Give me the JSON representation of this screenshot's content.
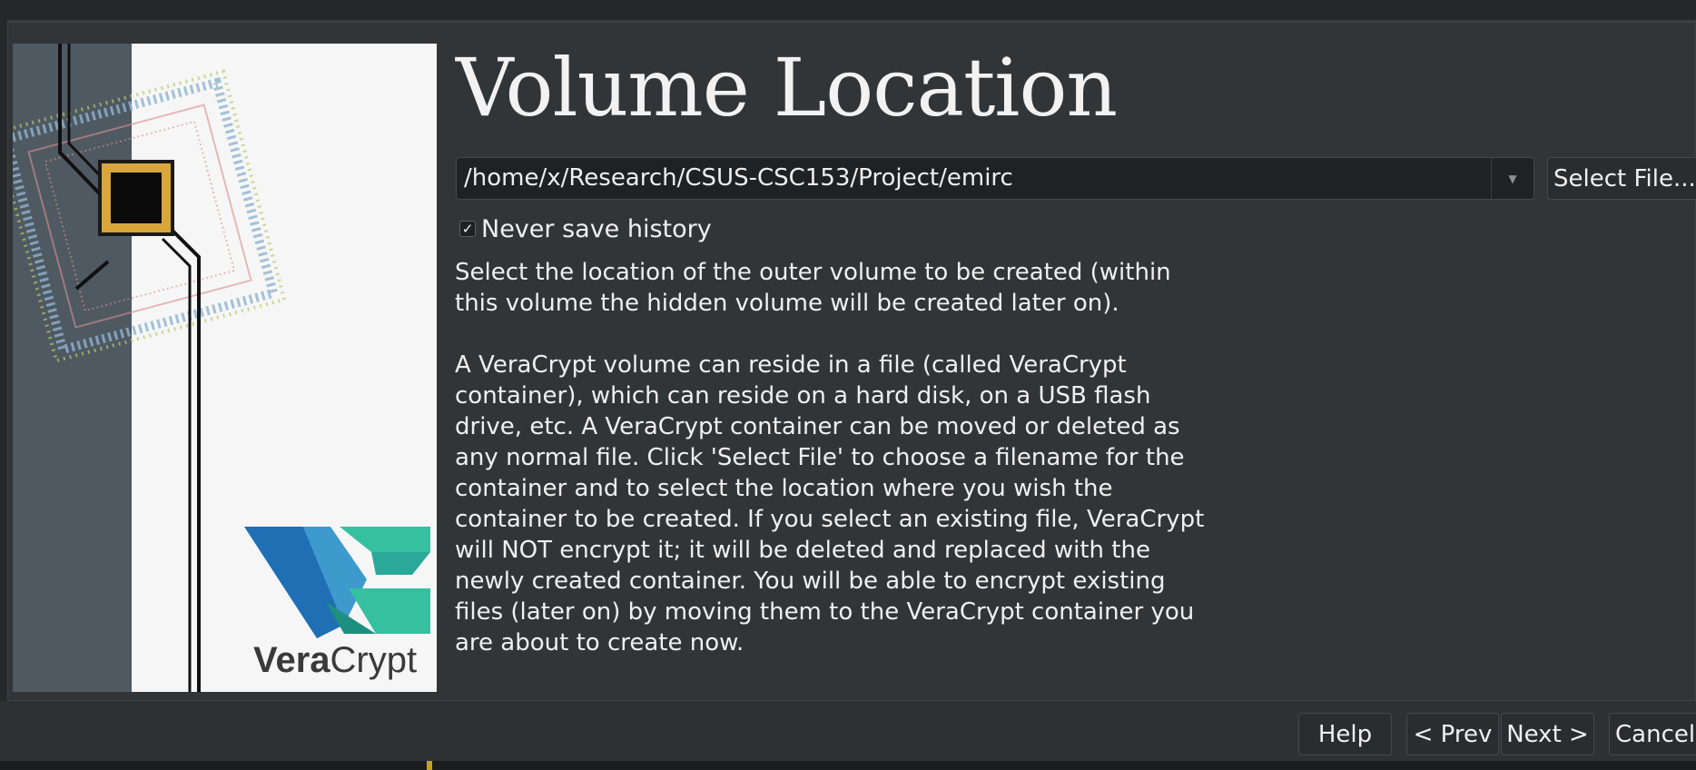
{
  "wizard": {
    "heading": "Volume Location",
    "path_value": "/home/x/Research/CSUS-CSC153/Project/emirc",
    "select_file_label": "Select File...",
    "never_save_history_label": "Never save history",
    "never_save_history_checked": true,
    "description_paragraphs": [
      "Select the location of the outer volume to be created (within this volume the hidden volume will be created later on).",
      "A VeraCrypt volume can reside in a file (called VeraCrypt container), which can reside on a hard disk, on a USB flash drive, etc. A VeraCrypt container can be moved or deleted as any normal file. Click 'Select File' to choose a filename for the container and to select the location where you wish the container to be created. If you select an existing file, VeraCrypt will NOT encrypt it; it will be deleted and replaced with the newly created container. You will be able to encrypt existing files (later on) by moving them to the VeraCrypt container you are about to create now."
    ]
  },
  "brand": {
    "logo_text_bold": "Vera",
    "logo_text_light": "Crypt",
    "logo_colors": [
      "#1f6fb5",
      "#2aa89a",
      "#36c0a0"
    ]
  },
  "buttons": {
    "help": "Help",
    "prev": "< Prev",
    "next": "Next >",
    "cancel": "Cancel"
  },
  "icons": {
    "combo_arrow": "chevron-down-icon",
    "checkbox_mark": "check-icon"
  }
}
